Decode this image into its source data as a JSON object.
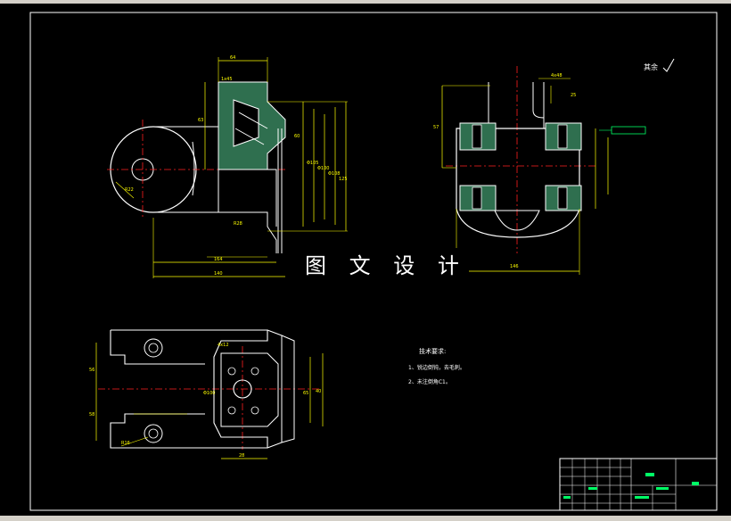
{
  "app": {
    "title": ""
  },
  "watermark": {
    "text": "图 文 设 计"
  },
  "drawing": {
    "roughness_symbol": "其余",
    "tech_requirements": {
      "title": "技术要求:",
      "items": [
        "1、锐边倒钝，去毛刺。",
        "2、未注倒角C1。"
      ]
    },
    "title_block": {
      "part_name": "",
      "drawing_no": "",
      "scale": ""
    },
    "colors": {
      "background": "#000000",
      "outline": "#ffffff",
      "dimension": "#ffff00",
      "center": "#ff2020",
      "hatch": "#00ff00",
      "section_fill": "#2f6f4f",
      "highlight": "#00ff66"
    },
    "dims": {
      "top_width": "64",
      "top_chamfer": "1x45",
      "dim_63": "63",
      "dim_60": "60",
      "dim_105": "Φ105",
      "dim_100": "Φ100",
      "dim_108": "Φ108",
      "dim_125": "125",
      "dim_164": "164",
      "dim_r22": "R22",
      "dim_r28": "R28",
      "dim_140": "140",
      "right_width": "146",
      "right_height": "57",
      "right_small": "4x48",
      "dim_25": "25",
      "left_56": "56",
      "left_58": "58",
      "left_100": "Φ100",
      "bottom_r": "R16",
      "dim_65": "65",
      "dim_40": "40",
      "dim_28": "28",
      "dim_4x12": "4x12"
    }
  }
}
